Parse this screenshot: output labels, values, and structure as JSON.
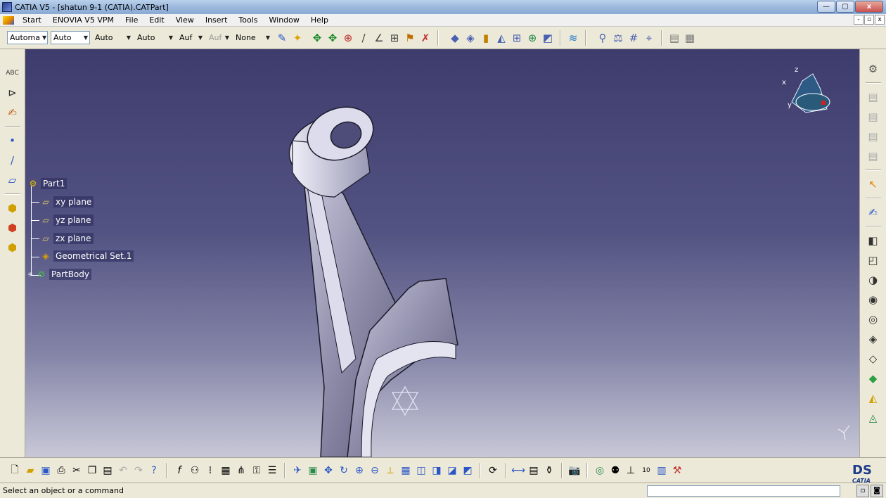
{
  "window": {
    "title": "CATIA V5 - [shatun 9-1 (CATIA).CATPart]",
    "minimize": "—",
    "maximize": "▢",
    "close": "x"
  },
  "menu": {
    "items": [
      "Start",
      "ENOVIA V5 VPM",
      "File",
      "Edit",
      "View",
      "Insert",
      "Tools",
      "Window",
      "Help"
    ],
    "mdi_controls": [
      "-",
      "▫",
      "x"
    ]
  },
  "toolbar": {
    "combos": [
      {
        "value": "Automa",
        "dim": false
      },
      {
        "value": "Auto",
        "dim": false
      },
      {
        "value": "Auto",
        "dim": false,
        "plain": true
      },
      {
        "value": "Auto",
        "dim": false,
        "plain": true
      },
      {
        "value": "Auf",
        "dim": false,
        "plain": true
      },
      {
        "value": "Auf",
        "dim": true,
        "plain": true
      },
      {
        "value": "None",
        "dim": false,
        "plain": true
      }
    ]
  },
  "tree": {
    "root": "Part1",
    "children": [
      "xy plane",
      "yz plane",
      "zx plane",
      "Geometrical Set.1",
      "PartBody"
    ]
  },
  "compass": {
    "x": "x",
    "y": "y",
    "z": "z"
  },
  "status": {
    "message": "Select an object or a command"
  },
  "logo": {
    "brand": "CATIA",
    "mark": "DS"
  },
  "colors": {
    "viewport_top": "#3e3c6c",
    "viewport_bottom": "#c8c8d8",
    "part_face": "#7c7a98",
    "part_highlight": "#dcdcec"
  }
}
